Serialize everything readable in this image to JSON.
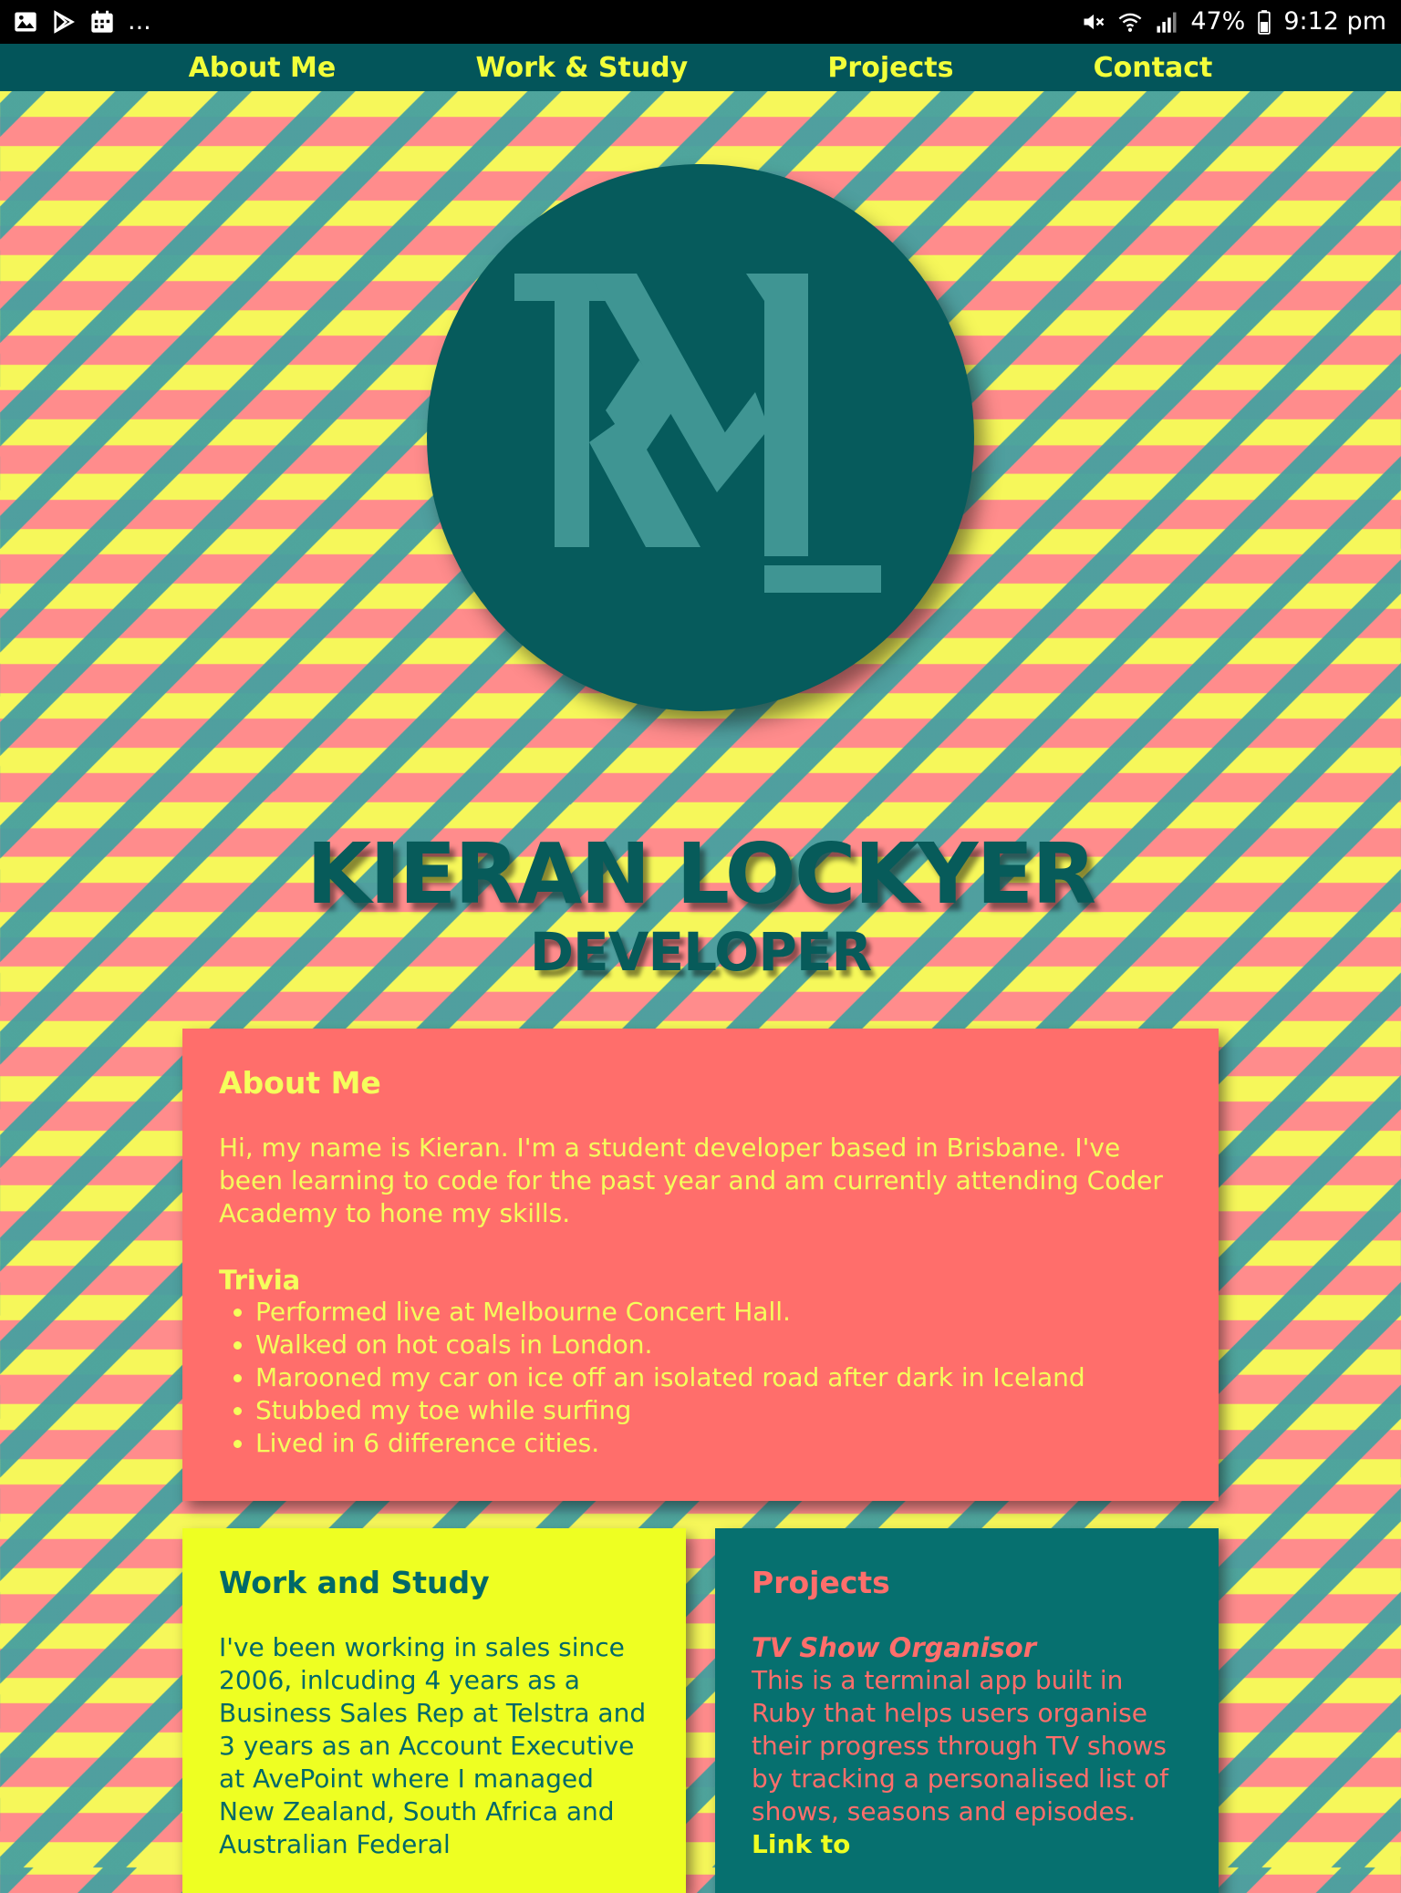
{
  "statusbar": {
    "battery": "47%",
    "time": "9:12 pm",
    "overflow": "..."
  },
  "nav": {
    "items": [
      "About Me",
      "Work & Study",
      "Projects",
      "Contact"
    ]
  },
  "logo": {
    "icon": "kml-monogram-icon",
    "monogram": "KML"
  },
  "hero": {
    "name": "KIERAN LOCKYER",
    "role": "DEVELOPER"
  },
  "about": {
    "heading": "About Me",
    "intro": "Hi, my name is Kieran. I'm a student developer based in Brisbane. I've been learning to code for the past year and am currently attending Coder Academy to hone my skills.",
    "trivia_heading": "Trivia",
    "trivia": [
      "Performed live at Melbourne Concert Hall.",
      "Walked on hot coals in London.",
      "Marooned my car on ice off an isolated road after dark in Iceland",
      "Stubbed my toe while surfing",
      "Lived in 6 difference cities."
    ]
  },
  "work": {
    "heading": "Work and Study",
    "text": "I've been working in sales since 2006, inlcuding 4 years as a Business Sales Rep at Telstra and 3 years as an Account Executive at AvePoint where I managed New Zealand, South Africa and Australian Federal"
  },
  "projects": {
    "heading": "Projects",
    "project_title": "TV Show Organisor",
    "project_text": "This is a terminal app built in Ruby that helps users organise their progress through TV shows by tracking a personalised list of shows, seasons and episodes.",
    "link_label": "Link to"
  },
  "colors": {
    "teal_dark": "#03555a",
    "teal": "#06706f",
    "coral": "#ff6e6b",
    "yellow": "#eeff22"
  }
}
